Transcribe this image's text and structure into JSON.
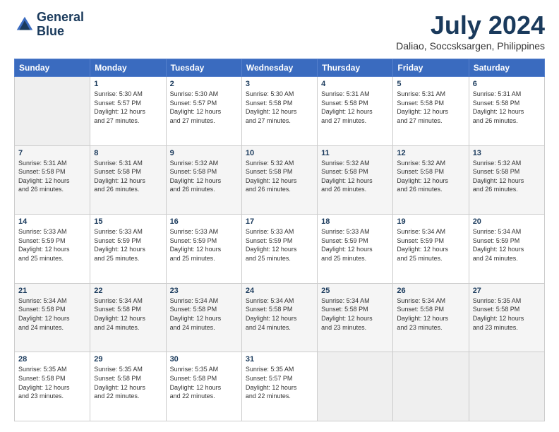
{
  "logo": {
    "line1": "General",
    "line2": "Blue"
  },
  "title": "July 2024",
  "subtitle": "Daliao, Soccsksargen, Philippines",
  "header_days": [
    "Sunday",
    "Monday",
    "Tuesday",
    "Wednesday",
    "Thursday",
    "Friday",
    "Saturday"
  ],
  "weeks": [
    {
      "bg": "white",
      "days": [
        {
          "num": "",
          "info": ""
        },
        {
          "num": "1",
          "info": "Sunrise: 5:30 AM\nSunset: 5:57 PM\nDaylight: 12 hours\nand 27 minutes."
        },
        {
          "num": "2",
          "info": "Sunrise: 5:30 AM\nSunset: 5:57 PM\nDaylight: 12 hours\nand 27 minutes."
        },
        {
          "num": "3",
          "info": "Sunrise: 5:30 AM\nSunset: 5:58 PM\nDaylight: 12 hours\nand 27 minutes."
        },
        {
          "num": "4",
          "info": "Sunrise: 5:31 AM\nSunset: 5:58 PM\nDaylight: 12 hours\nand 27 minutes."
        },
        {
          "num": "5",
          "info": "Sunrise: 5:31 AM\nSunset: 5:58 PM\nDaylight: 12 hours\nand 27 minutes."
        },
        {
          "num": "6",
          "info": "Sunrise: 5:31 AM\nSunset: 5:58 PM\nDaylight: 12 hours\nand 26 minutes."
        }
      ]
    },
    {
      "bg": "light",
      "days": [
        {
          "num": "7",
          "info": "Sunrise: 5:31 AM\nSunset: 5:58 PM\nDaylight: 12 hours\nand 26 minutes."
        },
        {
          "num": "8",
          "info": "Sunrise: 5:31 AM\nSunset: 5:58 PM\nDaylight: 12 hours\nand 26 minutes."
        },
        {
          "num": "9",
          "info": "Sunrise: 5:32 AM\nSunset: 5:58 PM\nDaylight: 12 hours\nand 26 minutes."
        },
        {
          "num": "10",
          "info": "Sunrise: 5:32 AM\nSunset: 5:58 PM\nDaylight: 12 hours\nand 26 minutes."
        },
        {
          "num": "11",
          "info": "Sunrise: 5:32 AM\nSunset: 5:58 PM\nDaylight: 12 hours\nand 26 minutes."
        },
        {
          "num": "12",
          "info": "Sunrise: 5:32 AM\nSunset: 5:58 PM\nDaylight: 12 hours\nand 26 minutes."
        },
        {
          "num": "13",
          "info": "Sunrise: 5:32 AM\nSunset: 5:58 PM\nDaylight: 12 hours\nand 26 minutes."
        }
      ]
    },
    {
      "bg": "white",
      "days": [
        {
          "num": "14",
          "info": "Sunrise: 5:33 AM\nSunset: 5:59 PM\nDaylight: 12 hours\nand 25 minutes."
        },
        {
          "num": "15",
          "info": "Sunrise: 5:33 AM\nSunset: 5:59 PM\nDaylight: 12 hours\nand 25 minutes."
        },
        {
          "num": "16",
          "info": "Sunrise: 5:33 AM\nSunset: 5:59 PM\nDaylight: 12 hours\nand 25 minutes."
        },
        {
          "num": "17",
          "info": "Sunrise: 5:33 AM\nSunset: 5:59 PM\nDaylight: 12 hours\nand 25 minutes."
        },
        {
          "num": "18",
          "info": "Sunrise: 5:33 AM\nSunset: 5:59 PM\nDaylight: 12 hours\nand 25 minutes."
        },
        {
          "num": "19",
          "info": "Sunrise: 5:34 AM\nSunset: 5:59 PM\nDaylight: 12 hours\nand 25 minutes."
        },
        {
          "num": "20",
          "info": "Sunrise: 5:34 AM\nSunset: 5:59 PM\nDaylight: 12 hours\nand 24 minutes."
        }
      ]
    },
    {
      "bg": "light",
      "days": [
        {
          "num": "21",
          "info": "Sunrise: 5:34 AM\nSunset: 5:58 PM\nDaylight: 12 hours\nand 24 minutes."
        },
        {
          "num": "22",
          "info": "Sunrise: 5:34 AM\nSunset: 5:58 PM\nDaylight: 12 hours\nand 24 minutes."
        },
        {
          "num": "23",
          "info": "Sunrise: 5:34 AM\nSunset: 5:58 PM\nDaylight: 12 hours\nand 24 minutes."
        },
        {
          "num": "24",
          "info": "Sunrise: 5:34 AM\nSunset: 5:58 PM\nDaylight: 12 hours\nand 24 minutes."
        },
        {
          "num": "25",
          "info": "Sunrise: 5:34 AM\nSunset: 5:58 PM\nDaylight: 12 hours\nand 23 minutes."
        },
        {
          "num": "26",
          "info": "Sunrise: 5:34 AM\nSunset: 5:58 PM\nDaylight: 12 hours\nand 23 minutes."
        },
        {
          "num": "27",
          "info": "Sunrise: 5:35 AM\nSunset: 5:58 PM\nDaylight: 12 hours\nand 23 minutes."
        }
      ]
    },
    {
      "bg": "white",
      "days": [
        {
          "num": "28",
          "info": "Sunrise: 5:35 AM\nSunset: 5:58 PM\nDaylight: 12 hours\nand 23 minutes."
        },
        {
          "num": "29",
          "info": "Sunrise: 5:35 AM\nSunset: 5:58 PM\nDaylight: 12 hours\nand 22 minutes."
        },
        {
          "num": "30",
          "info": "Sunrise: 5:35 AM\nSunset: 5:58 PM\nDaylight: 12 hours\nand 22 minutes."
        },
        {
          "num": "31",
          "info": "Sunrise: 5:35 AM\nSunset: 5:57 PM\nDaylight: 12 hours\nand 22 minutes."
        },
        {
          "num": "",
          "info": ""
        },
        {
          "num": "",
          "info": ""
        },
        {
          "num": "",
          "info": ""
        }
      ]
    }
  ]
}
